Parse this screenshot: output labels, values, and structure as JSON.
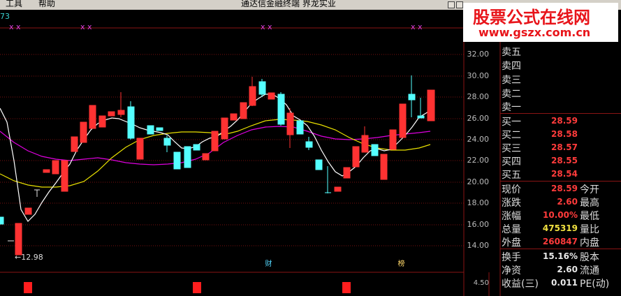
{
  "window": {
    "menu": [
      "工具",
      "帮助"
    ],
    "title": "通达信金融终端  界龙实业"
  },
  "watermark": {
    "title": "股票公式在线网",
    "url": "www.gszx.com.cn"
  },
  "chart": {
    "code_fragment": "73",
    "marker_glyph": "x x",
    "low_label": "←12.98",
    "event_markers": [
      "财",
      "榜"
    ],
    "y_axis": [
      "32.00",
      "30.00",
      "28.00",
      "26.00",
      "24.00",
      "22.00",
      "20.00",
      "18.00",
      "16.00",
      "14.00"
    ],
    "volume_axis": "4.50"
  },
  "colors": {
    "up": "#ff3232",
    "down": "#54ffff",
    "ma_white": "#ffffff",
    "ma_yellow": "#e8e000",
    "ma_magenta": "#e000e0",
    "grid": "#7a1010"
  },
  "quote": {
    "ask": [
      {
        "label": "卖五"
      },
      {
        "label": "卖四"
      },
      {
        "label": "卖三"
      },
      {
        "label": "卖二"
      },
      {
        "label": "卖一"
      }
    ],
    "bid": [
      {
        "label": "买一",
        "value": "28.59"
      },
      {
        "label": "买二",
        "value": "28.58"
      },
      {
        "label": "买三",
        "value": "28.57"
      },
      {
        "label": "买四",
        "value": "28.55"
      },
      {
        "label": "买五",
        "value": "28.54"
      }
    ],
    "stats1": [
      {
        "label": "现价",
        "value": "28.59",
        "label2": "今开"
      },
      {
        "label": "涨跌",
        "value": "2.60",
        "label2": "最高"
      },
      {
        "label": "涨幅",
        "value": "10.00%",
        "label2": "最低"
      },
      {
        "label": "总量",
        "value": "475319",
        "label2": "量比"
      },
      {
        "label": "外盘",
        "value": "260847",
        "label2": "内盘"
      }
    ],
    "stats2": [
      {
        "label": "换手",
        "value": "15.16%",
        "label2": "股本"
      },
      {
        "label": "净资",
        "value": "2.60",
        "label2": "流通"
      },
      {
        "label": "收益(三)",
        "value": "0.011",
        "label2": "PE(动)"
      }
    ]
  }
}
